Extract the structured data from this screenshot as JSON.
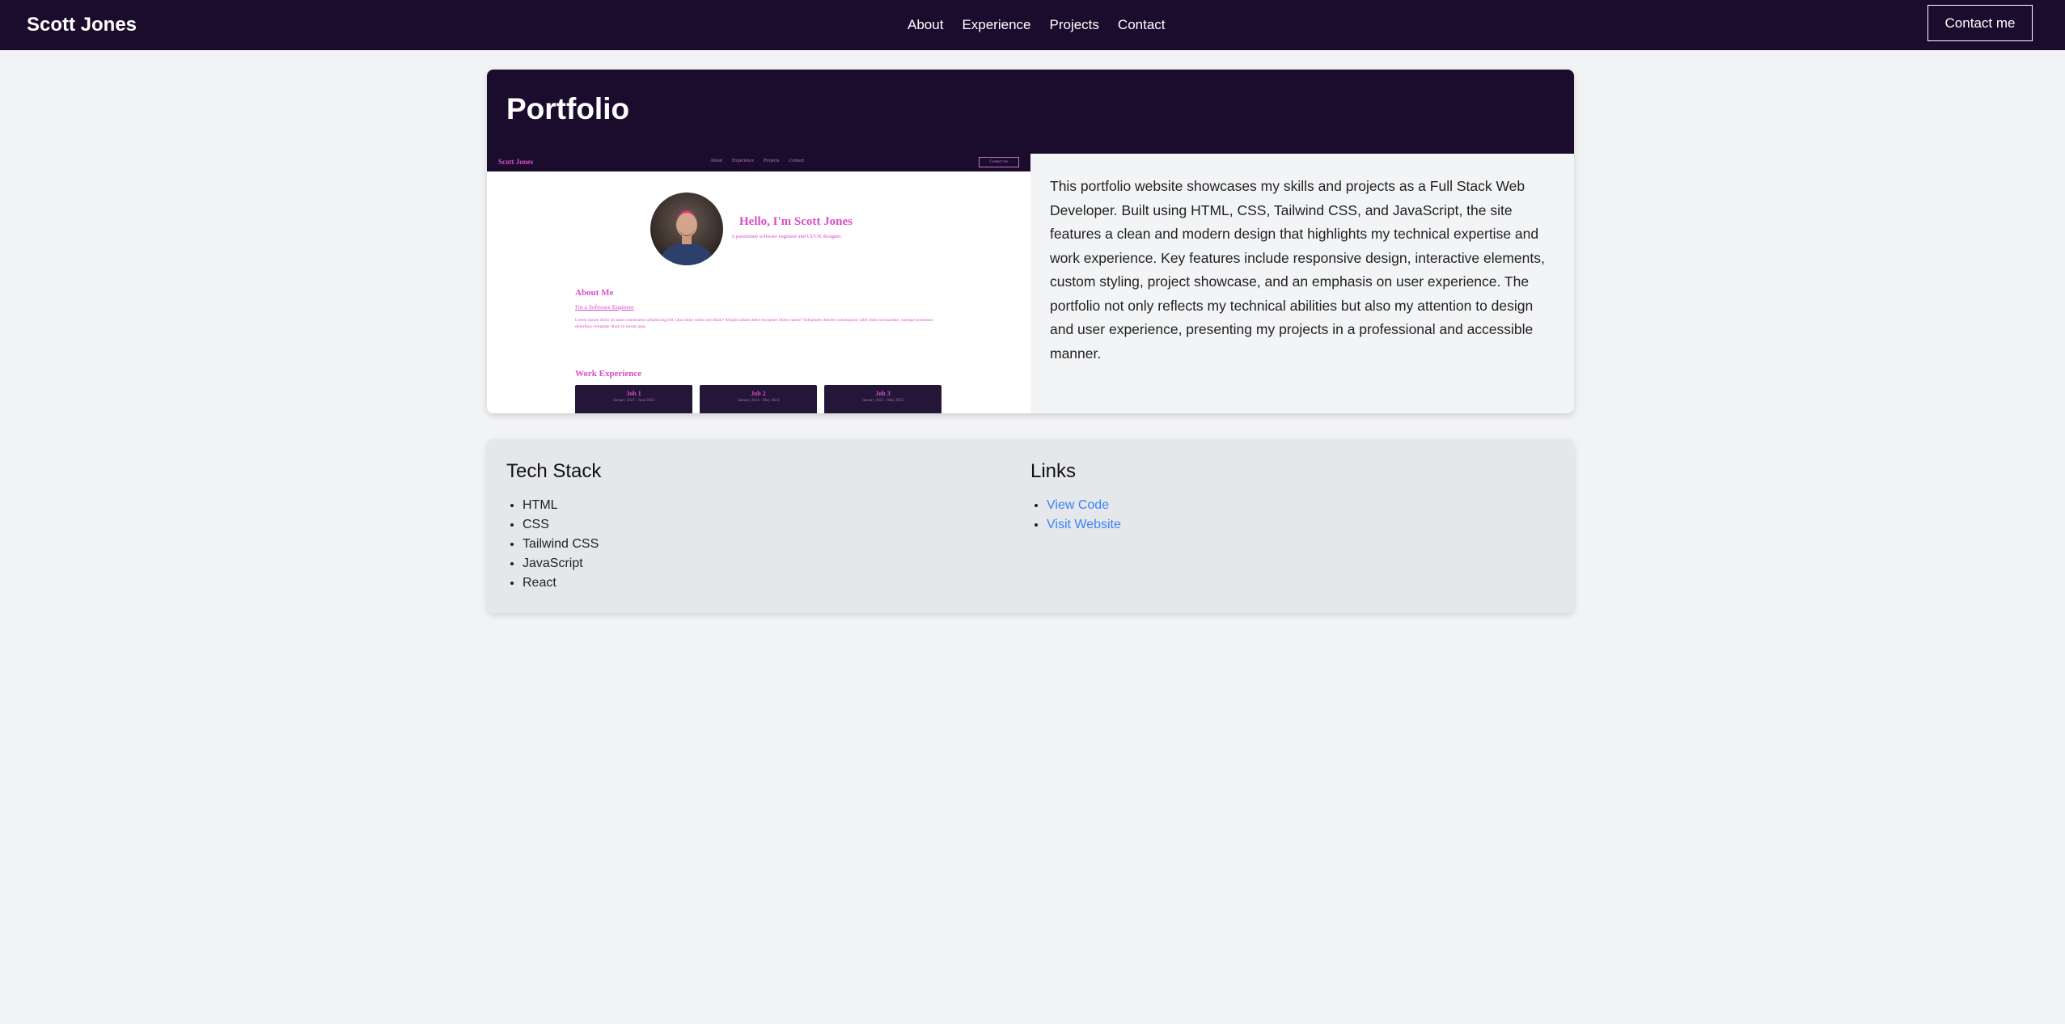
{
  "navbar": {
    "brand": "Scott Jones",
    "links": [
      "About",
      "Experience",
      "Projects",
      "Contact"
    ],
    "cta": "Contact me"
  },
  "portfolio": {
    "title": "Portfolio",
    "description": "This portfolio website showcases my skills and projects as a Full Stack Web Developer. Built using HTML, CSS, Tailwind CSS, and JavaScript, the site features a clean and modern design that highlights my technical expertise and work experience. Key features include responsive design, interactive elements, custom styling, project showcase, and an emphasis on user experience. The portfolio not only reflects my technical abilities but also my attention to design and user experience, presenting my projects in a professional and accessible manner.",
    "preview": {
      "brand": "Scott Jones",
      "links": [
        "About",
        "Experience",
        "Projects",
        "Contact"
      ],
      "cta": "Contact me",
      "hello": "Hello, I'm Scott Jones",
      "tagline": "A passionate software engineer and UI/UX designer.",
      "about_title": "About Me",
      "about_sub": "I'm a Software Engineer",
      "about_text": "Lorem ipsum dolor sit amet consectetur adipisicing elit. Quo dolor nobis sed illum? Aliquid ullam dolor excepturi libero natus? Voluptates dolores consequatur nihil enim recusandae, cumque possimus doloribus voluptate illum in rerum quia.",
      "work_title": "Work Experience",
      "jobs": [
        {
          "title": "Job 1",
          "dates": "January 2023 - June 2023"
        },
        {
          "title": "Job 2",
          "dates": "January 2024 - May 2024"
        },
        {
          "title": "Job 3",
          "dates": "January 2025 - May 2025"
        }
      ]
    }
  },
  "tech_stack": {
    "title": "Tech Stack",
    "items": [
      "HTML",
      "CSS",
      "Tailwind CSS",
      "JavaScript",
      "React"
    ]
  },
  "links": {
    "title": "Links",
    "items": [
      "View Code",
      "Visit Website"
    ]
  }
}
